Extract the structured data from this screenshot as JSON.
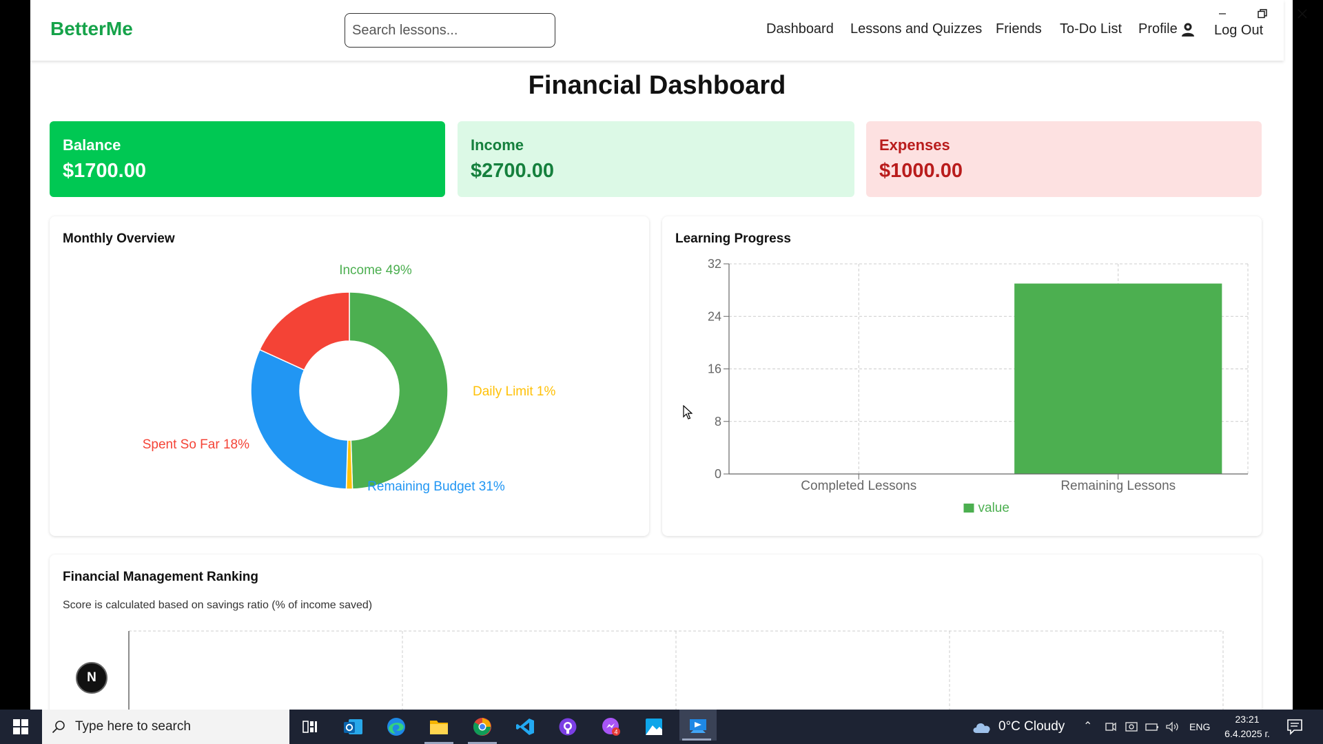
{
  "navbar": {
    "logo": "BetterMe",
    "search_placeholder": "Search lessons...",
    "links": {
      "dashboard": "Dashboard",
      "lessons": "Lessons and Quizzes",
      "friends": "Friends",
      "todo": "To-Do List",
      "profile": "Profile",
      "logout": "Log Out"
    }
  },
  "page_title": "Financial Dashboard",
  "cards": {
    "balance": {
      "label": "Balance",
      "value": "$1700.00",
      "color": "#00c853"
    },
    "income": {
      "label": "Income",
      "value": "$2700.00",
      "color": "#dcf9e6"
    },
    "expenses": {
      "label": "Expenses",
      "value": "$1000.00",
      "color": "#fde1e1"
    }
  },
  "monthly_overview": {
    "title": "Monthly Overview"
  },
  "learning_progress": {
    "title": "Learning Progress"
  },
  "ranking": {
    "title": "Financial Management Ranking",
    "description": "Score is calculated based on savings ratio (% of income saved)"
  },
  "chart_data": [
    {
      "type": "pie",
      "donut": true,
      "labels": [
        "Income 49%",
        "Daily Limit 1%",
        "Remaining Budget 31%",
        "Spent So Far 18%"
      ],
      "values": [
        49,
        1,
        31,
        18
      ],
      "colors": [
        "#4caf50",
        "#ffc107",
        "#2196f3",
        "#f44336"
      ]
    },
    {
      "type": "bar",
      "categories": [
        "Completed Lessons",
        "Remaining Lessons"
      ],
      "series": [
        {
          "name": "value",
          "values": [
            0,
            29
          ],
          "color": "#4caf50"
        }
      ],
      "ylim": [
        0,
        32
      ],
      "yticks": [
        0,
        8,
        16,
        24,
        32
      ],
      "grid": true,
      "legend": "bottom"
    }
  ],
  "floating_badge": "N",
  "taskbar": {
    "search_text": "Type here to search",
    "weather": "0°C  Cloudy",
    "lang": "ENG",
    "time": "23:21",
    "date": "6.4.2025 г.",
    "mail_badge": "4",
    "apps": [
      "task-view-icon",
      "outlook-icon",
      "edge-icon",
      "file-explorer-icon",
      "chrome-icon",
      "vscode-icon",
      "github-icon",
      "messenger-icon",
      "paint-icon",
      "remote-desktop-icon"
    ]
  }
}
